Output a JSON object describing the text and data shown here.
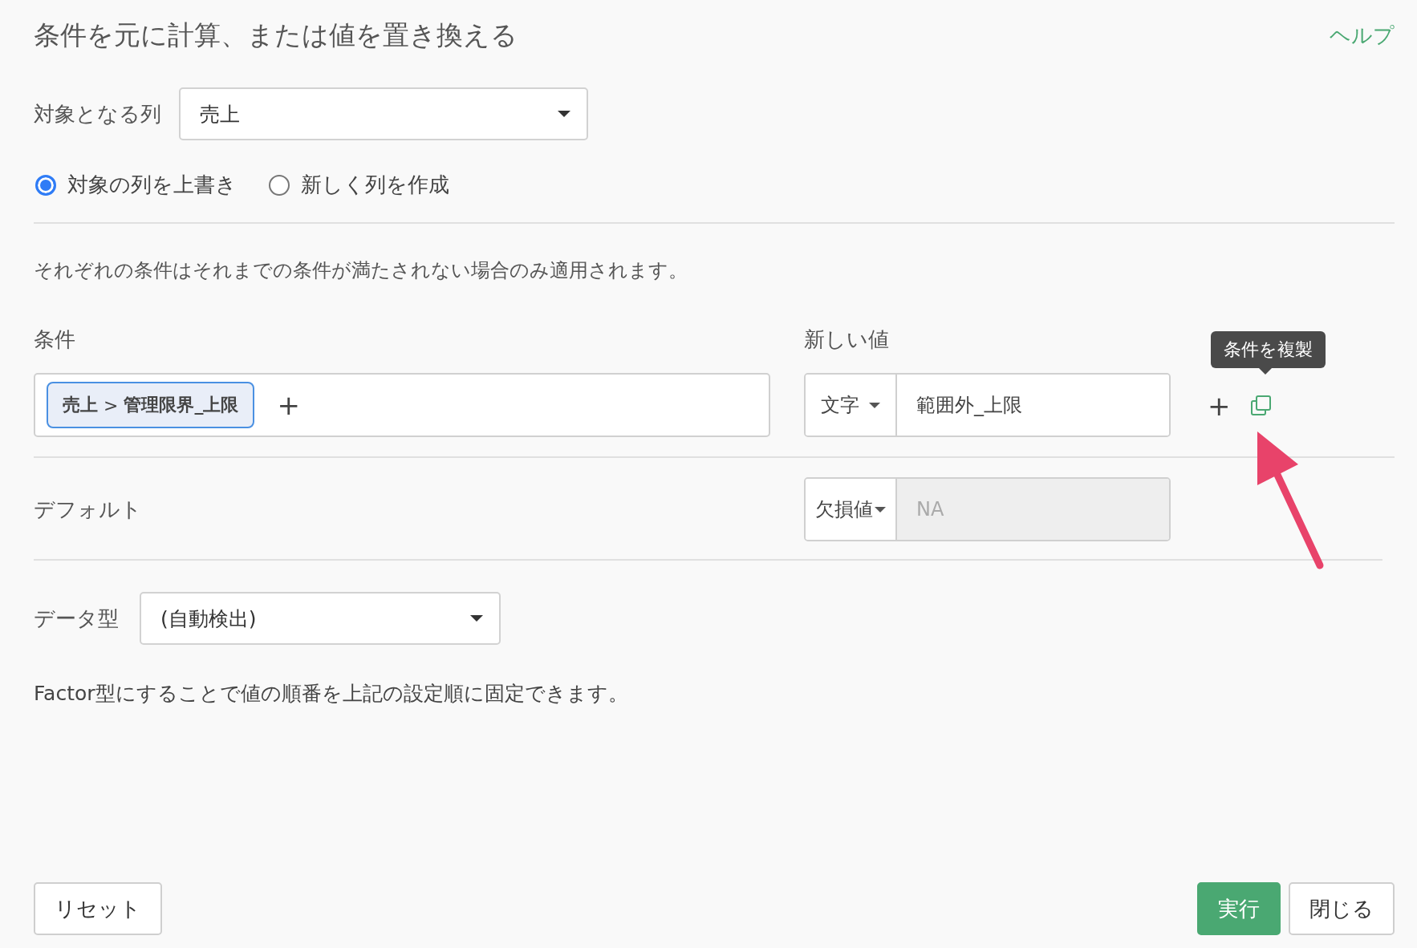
{
  "title": "条件を元に計算、または値を置き換える",
  "help_link": "ヘルプ",
  "target_column": {
    "label": "対象となる列",
    "value": "売上"
  },
  "output_options": [
    {
      "label": "対象の列を上書き",
      "selected": true
    },
    {
      "label": "新しく列を作成",
      "selected": false
    }
  ],
  "description": "それぞれの条件はそれまでの条件が満たされない場合のみ適用されます。",
  "headers": {
    "condition": "条件",
    "new_value": "新しい値"
  },
  "conditions": [
    {
      "chip": "**売上** > **管理限界_上限**",
      "add_condition": "+",
      "value_type": "文字",
      "value": "範囲外_上限",
      "add_row": "+",
      "copy_tooltip": "条件を複製"
    }
  ],
  "default": {
    "label": "デフォルト",
    "value_type": "欠損値",
    "placeholder": "NA",
    "disabled": true
  },
  "data_type": {
    "label": "データ型",
    "value": "(自動検出)"
  },
  "note": "Factor型にすることで値の順番を上記の設定順に固定できます。",
  "footer": {
    "reset": "リセット",
    "run": "実行",
    "close": "閉じる"
  }
}
